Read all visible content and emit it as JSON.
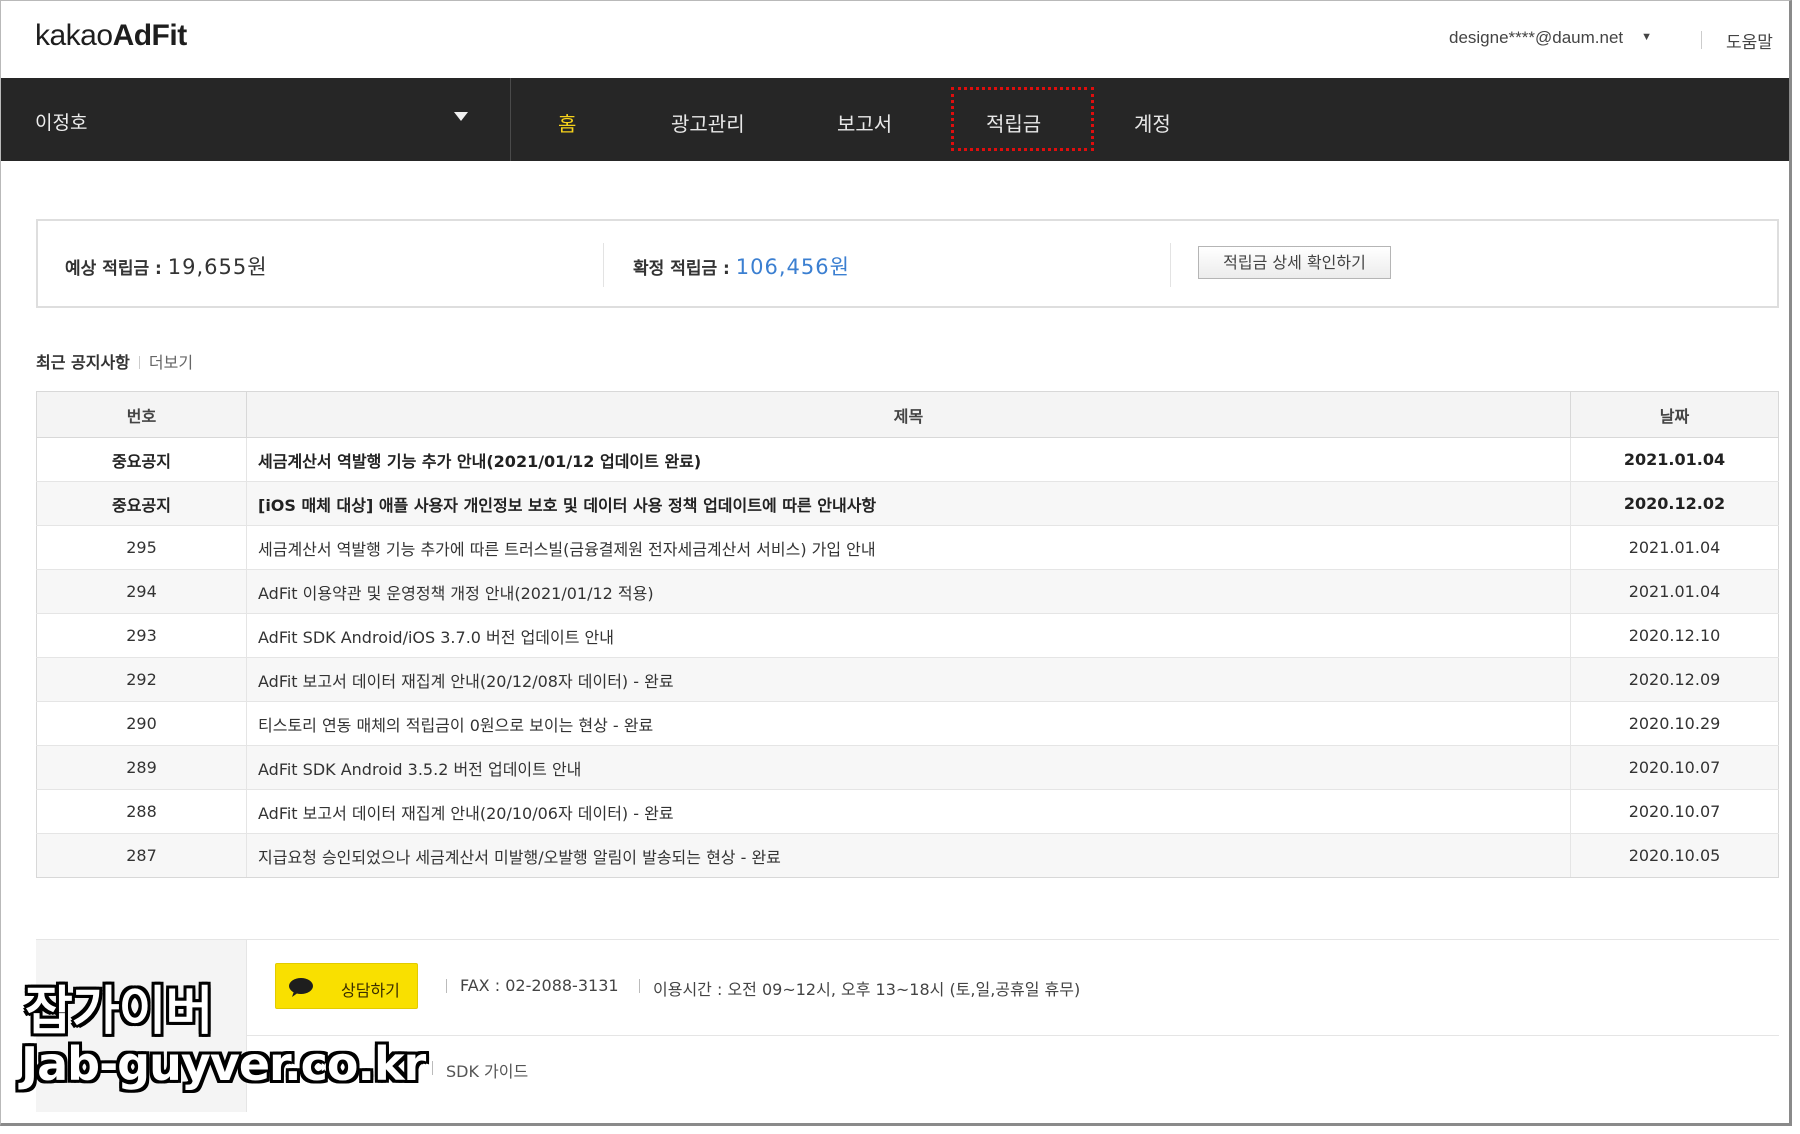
{
  "header": {
    "logo_prefix": "kakao",
    "logo_suffix": "AdFit",
    "account": "designe****@daum.net",
    "help": "도움말"
  },
  "nav": {
    "site_name": "이정호",
    "items": [
      {
        "label": "홈"
      },
      {
        "label": "광고관리"
      },
      {
        "label": "보고서"
      },
      {
        "label": "적립금"
      },
      {
        "label": "계정"
      }
    ],
    "active_color": "#f7d21b",
    "highlight_color": "#e00d0d"
  },
  "summary": {
    "expected_label": "예상 적립금 : ",
    "expected_value": "19,655원",
    "confirmed_label": "확정 적립금 : ",
    "confirmed_value": "106,456원",
    "detail_button": "적립금 상세 확인하기"
  },
  "notices": {
    "title": "최근 공지사항",
    "more": "더보기",
    "columns": [
      "번호",
      "제목",
      "날짜"
    ],
    "rows": [
      {
        "num": "중요공지",
        "title": "세금계산서 역발행 기능 추가 안내(2021/01/12 업데이트 완료)",
        "date": "2021.01.04"
      },
      {
        "num": "중요공지",
        "title": "[iOS 매체 대상] 애플 사용자 개인정보 보호 및 데이터 사용 정책 업데이트에 따른 안내사항",
        "date": "2020.12.02"
      },
      {
        "num": "295",
        "title": "세금계산서 역발행 기능 추가에 따른 트러스빌(금융결제원 전자세금계산서 서비스) 가입 안내",
        "date": "2021.01.04"
      },
      {
        "num": "294",
        "title": "AdFit 이용약관 및 운영정책 개정 안내(2021/01/12 적용)",
        "date": "2021.01.04"
      },
      {
        "num": "293",
        "title": "AdFit SDK Android/iOS 3.7.0 버전 업데이트 안내",
        "date": "2020.12.10"
      },
      {
        "num": "292",
        "title": "AdFit 보고서 데이터 재집계 안내(20/12/08자 데이터) - 완료",
        "date": "2020.12.09"
      },
      {
        "num": "290",
        "title": "티스토리 연동 매체의 적립금이 0원으로 보이는 현상 - 완료",
        "date": "2020.10.29"
      },
      {
        "num": "289",
        "title": "AdFit SDK Android 3.5.2 버전 업데이트 안내",
        "date": "2020.10.07"
      },
      {
        "num": "288",
        "title": "AdFit 보고서 데이터 재집계 안내(20/10/06자 데이터) - 완료",
        "date": "2020.10.07"
      },
      {
        "num": "287",
        "title": "지급요청 승인되었으나 세금계산서 미발행/오발행 알림이 발송되는 현상 - 완료",
        "date": "2020.10.05"
      }
    ]
  },
  "support": {
    "chat_button": "상담하기",
    "fax": "FAX :  02-2088-3131",
    "hours": "이용시간 :  오전 09~12시, 오후 13~18시 (토,일,공휴일 휴무)",
    "sdk_guide": "SDK 가이드",
    "chat_color": "#f9e000"
  },
  "watermark": {
    "line1": "잡가이버",
    "line2": "Jab-guyver.co.kr"
  }
}
